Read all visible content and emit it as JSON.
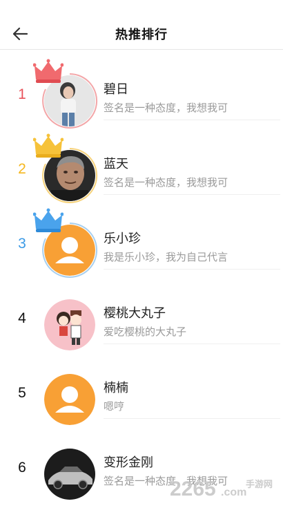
{
  "header": {
    "title": "热推排行",
    "back_icon": "arrow-left-icon"
  },
  "colors": {
    "rank1": "#e8525a",
    "rank2": "#f5b71e",
    "rank3": "#3b9ae6",
    "crown1": "#f06a6e",
    "crown2": "#f6c23a",
    "crown3": "#3b9ae6",
    "default_avatar_bg": "#f8a035",
    "text_primary": "#222222",
    "text_secondary": "#9a9a9a"
  },
  "rankings": [
    {
      "rank": "1",
      "name": "碧日",
      "signature": "签名是一种态度，我想我可",
      "avatar": "photo-woman",
      "crown": "red-crown-icon"
    },
    {
      "rank": "2",
      "name": "蓝天",
      "signature": "签名是一种态度，我想我可",
      "avatar": "photo-man",
      "crown": "gold-crown-icon"
    },
    {
      "rank": "3",
      "name": "乐小珍",
      "signature": "我是乐小珍，我为自己代言",
      "avatar": "default-user-icon",
      "crown": "blue-crown-icon"
    },
    {
      "rank": "4",
      "name": "樱桃大丸子",
      "signature": "爱吃樱桃的大丸子",
      "avatar": "cartoon-kids",
      "crown": ""
    },
    {
      "rank": "5",
      "name": "楠楠",
      "signature": "嗯哼",
      "avatar": "default-user-icon",
      "crown": ""
    },
    {
      "rank": "6",
      "name": "变形金刚",
      "signature": "签名是一种态度，我想我可",
      "avatar": "photo-car",
      "crown": ""
    }
  ],
  "watermark": {
    "brand": "2265",
    "domain": ".com",
    "label": "手游网"
  }
}
